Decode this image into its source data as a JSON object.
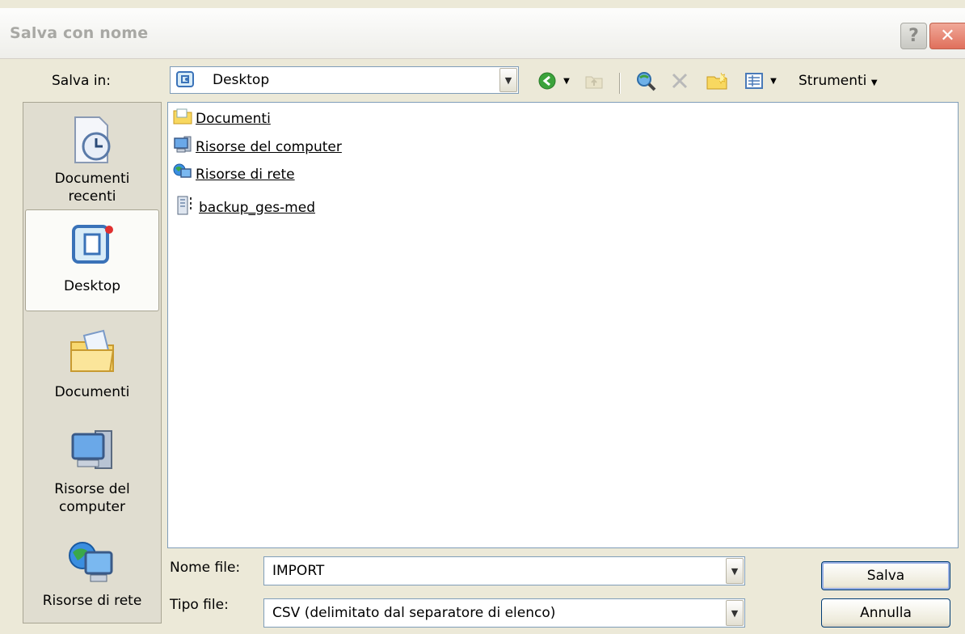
{
  "window": {
    "title": "Salva con nome",
    "help_glyph": "?",
    "close_glyph": "✕"
  },
  "save_in": {
    "label": "Salva in:",
    "value": "Desktop"
  },
  "toolbar": {
    "back_icon": "back-arrow-icon",
    "up_icon": "up-folder-icon",
    "search_icon": "search-web-icon",
    "delete_icon": "delete-icon",
    "new_folder_icon": "new-folder-icon",
    "views_icon": "views-icon",
    "tools_label": "Strumenti"
  },
  "places": [
    {
      "label1": "Documenti",
      "label2": "recenti",
      "icon": "recent-documents-icon"
    },
    {
      "label1": "Desktop",
      "label2": "",
      "icon": "desktop-icon"
    },
    {
      "label1": "Documenti",
      "label2": "",
      "icon": "my-documents-icon"
    },
    {
      "label1": "Risorse del",
      "label2": "computer",
      "icon": "my-computer-icon"
    },
    {
      "label1": "Risorse di rete",
      "label2": "",
      "icon": "network-places-icon"
    }
  ],
  "files": [
    {
      "name": "Documenti",
      "icon": "folder-documents-icon"
    },
    {
      "name": "Risorse del computer",
      "icon": "computer-icon"
    },
    {
      "name": "Risorse di rete",
      "icon": "network-icon"
    },
    {
      "name": "backup_ges-med",
      "icon": "archive-icon"
    }
  ],
  "filename": {
    "label": "Nome file:",
    "value": "IMPORT"
  },
  "filetype": {
    "label": "Tipo file:",
    "value": "CSV (delimitato dal separatore di elenco)"
  },
  "buttons": {
    "save": "Salva",
    "cancel": "Annulla"
  }
}
